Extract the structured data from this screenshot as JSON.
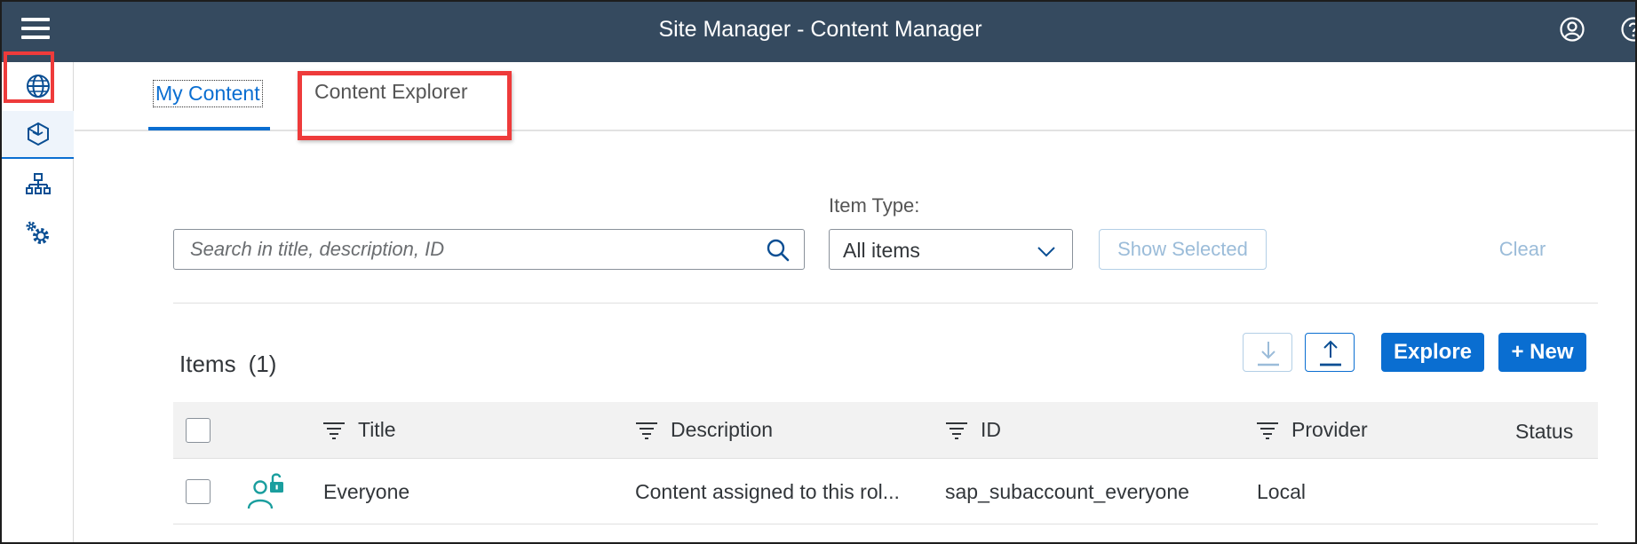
{
  "shell": {
    "title": "Site Manager - Content Manager",
    "colors": {
      "background": "#354a5f",
      "text": "#ffffff"
    },
    "icons": [
      "menu-icon",
      "user-icon",
      "help-icon"
    ]
  },
  "sidenav": {
    "items": [
      {
        "icon": "globe-icon",
        "selected": false
      },
      {
        "icon": "content-cube-icon",
        "selected": true
      },
      {
        "icon": "site-hierarchy-icon",
        "selected": false
      },
      {
        "icon": "settings-gears-icon",
        "selected": false
      }
    ]
  },
  "tabs": [
    {
      "label": "My Content",
      "selected": true
    },
    {
      "label": "Content Explorer",
      "selected": false
    }
  ],
  "filters": {
    "search_placeholder": "Search in title, description, ID",
    "search_value": "",
    "item_type_label": "Item Type:",
    "item_type_value": "All items",
    "show_selected_label": "Show Selected",
    "clear_label": "Clear"
  },
  "items": {
    "title": "Items",
    "count": "(1)",
    "explore_label": "Explore",
    "new_label": "+ New",
    "icons": [
      "download-icon",
      "upload-icon"
    ]
  },
  "table": {
    "columns": [
      "Title",
      "Description",
      "ID",
      "Provider",
      "Status"
    ],
    "rows": [
      {
        "icon": "role-unlocked-icon",
        "title": "Everyone",
        "description": "Content assigned to this rol...",
        "id": "sap_subaccount_everyone",
        "provider": "Local",
        "status": ""
      }
    ]
  },
  "colors": {
    "accent": "#0a6ed1",
    "highlight_box": "#ee3b3b",
    "role_icon": "#1a9e9e",
    "disabled_text": "#9bbcd9"
  }
}
